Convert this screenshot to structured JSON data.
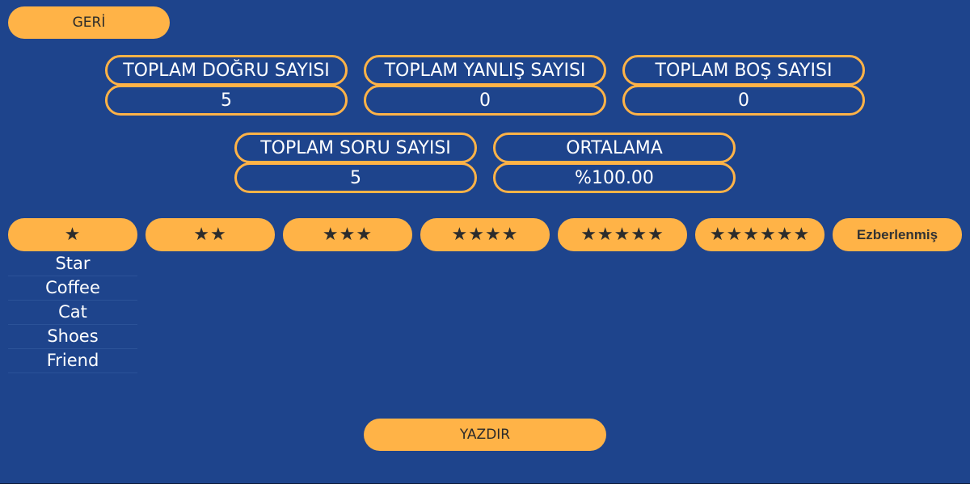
{
  "back_button": {
    "label": "GERİ"
  },
  "stats_row1": [
    {
      "label": "TOPLAM DOĞRU SAYISI",
      "value": "5"
    },
    {
      "label": "TOPLAM YANLIŞ SAYISI",
      "value": "0"
    },
    {
      "label": "TOPLAM BOŞ SAYISI",
      "value": "0"
    }
  ],
  "stats_row2": [
    {
      "label": "TOPLAM SORU SAYISI",
      "value": "5"
    },
    {
      "label": "ORTALAMA",
      "value": "%100.00"
    }
  ],
  "level_buttons": [
    {
      "label": "★"
    },
    {
      "label": "★★"
    },
    {
      "label": "★★★"
    },
    {
      "label": "★★★★"
    },
    {
      "label": "★★★★★"
    },
    {
      "label": "★★★★★★"
    },
    {
      "label": "Ezberlenmiş"
    }
  ],
  "word_list": [
    "Star",
    "Coffee",
    "Cat",
    "Shoes",
    "Friend"
  ],
  "print_button": {
    "label": "YAZDIR"
  }
}
